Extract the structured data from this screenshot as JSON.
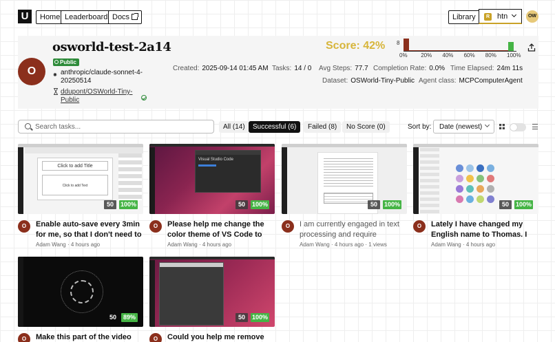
{
  "nav": {
    "logo": "U",
    "home": "Home",
    "leaderboards": "Leaderboards",
    "docs": "Docs",
    "library": "Library",
    "org_initial": "R",
    "org_name": "htn",
    "user_initials": "OW"
  },
  "run": {
    "avatar": "O",
    "title": "osworld-test-2a14",
    "visibility": "Public",
    "model": "anthropic/claude-sonnet-4-20250514",
    "dataset_link": "ddupont/OSWorld-Tiny-Public",
    "score": "Score: 42%",
    "created_label": "Created:",
    "created": "2025-09-14 01:45 AM",
    "tasks_label": "Tasks:",
    "tasks": "14 / 0",
    "avg_steps_label": "Avg Steps:",
    "avg_steps": "77.7",
    "completion_label": "Completion Rate:",
    "completion": "0.0%",
    "elapsed_label": "Time Elapsed:",
    "elapsed": "24m 11s",
    "dataset_label": "Dataset:",
    "dataset": "OSWorld-Tiny-Public",
    "agent_label": "Agent class:",
    "agent": "MCPComputerAgent"
  },
  "chart_data": {
    "type": "bar",
    "y_top_label": "8",
    "ylim": [
      0,
      8
    ],
    "x_ticks": [
      "0%",
      "20%",
      "40%",
      "60%",
      "80%",
      "100%"
    ],
    "bins": [
      {
        "range": "0-5%",
        "value": 8,
        "color": "#8b2f1c"
      },
      {
        "range": "5-95%",
        "value": 0.2,
        "color": "#8b2f1c"
      },
      {
        "range": "95-100%",
        "value": 6,
        "color": "#45b445"
      }
    ]
  },
  "toolbar": {
    "search_placeholder": "Search tasks...",
    "filters": [
      "All (14)",
      "Successful (6)",
      "Failed (8)",
      "No Score (0)"
    ],
    "sort_label": "Sort by:",
    "sort_value": "Date (newest)"
  },
  "cards": [
    {
      "title": "Enable auto-save every 3min for me, so that I don't need to hit \"ctr",
      "author": "Adam Wang",
      "time": "4 hours ago",
      "views": "",
      "steps": "50",
      "pct": "100%",
      "status": "success"
    },
    {
      "title": "Please help me change the color theme of VS Code to Visual Studio",
      "author": "Adam Wang",
      "time": "4 hours ago",
      "views": "",
      "steps": "50",
      "pct": "100%",
      "status": "success"
    },
    {
      "title": "I am currently engaged in text processing and require assistance in",
      "author": "Adam Wang",
      "time": "4 hours ago",
      "views": "1 views",
      "steps": "50",
      "pct": "100%",
      "status": "failed"
    },
    {
      "title": "Lately I have changed my English name to Thomas. I want to update",
      "author": "Adam Wang",
      "time": "4 hours ago",
      "views": "",
      "steps": "50",
      "pct": "100%",
      "status": "success"
    },
    {
      "title": "Make this part of the video my co",
      "author": "",
      "time": "",
      "views": "",
      "steps": "50",
      "pct": "89%",
      "status": "success"
    },
    {
      "title": "Could you help me remove the do",
      "author": "",
      "time": "",
      "views": "",
      "steps": "50",
      "pct": "100%",
      "status": "success"
    }
  ]
}
